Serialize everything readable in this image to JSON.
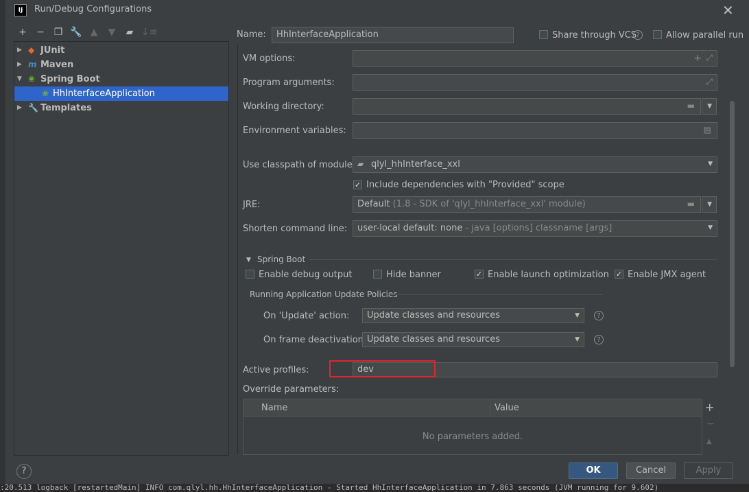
{
  "window": {
    "title": "Run/Debug Configurations",
    "logo": "IJ"
  },
  "toolbar": {
    "icons": [
      "add-icon",
      "remove-icon",
      "copy-icon",
      "wrench-icon",
      "move-up-icon",
      "move-down-icon",
      "folder-icon",
      "sort-icon"
    ]
  },
  "tree": {
    "items": [
      {
        "label": "JUnit",
        "icon": "junit-icon"
      },
      {
        "label": "Maven",
        "icon": "maven-icon"
      },
      {
        "label": "Spring Boot",
        "icon": "spring-boot-icon"
      },
      {
        "label": "HhInterfaceApplication",
        "icon": "spring-app-icon"
      },
      {
        "label": "Templates",
        "icon": "wrench-icon"
      }
    ]
  },
  "header": {
    "name_label": "Name:",
    "name_value": "HhInterfaceApplication",
    "share_label": "Share through VCS",
    "allow_parallel_label": "Allow parallel run"
  },
  "form": {
    "vm_options_label": "VM options:",
    "program_args_label": "Program arguments:",
    "working_dir_label": "Working directory:",
    "env_vars_label": "Environment variables:",
    "classpath_label": "Use classpath of module:",
    "classpath_value": "qlyl_hhInterface_xxl",
    "include_deps_label": "Include dependencies with \"Provided\" scope",
    "jre_label": "JRE:",
    "jre_value": "Default",
    "jre_detail": "(1.8 - SDK of 'qlyl_hhInterface_xxl' module)",
    "shorten_label": "Shorten command line:",
    "shorten_value": "user-local default: none",
    "shorten_detail": "- java [options] classname [args]"
  },
  "spring_boot": {
    "section_label": "Spring Boot",
    "enable_debug_label": "Enable debug output",
    "hide_banner_label": "Hide banner",
    "enable_launch_label": "Enable launch optimization",
    "enable_jmx_label": "Enable JMX agent",
    "policies_label": "Running Application Update Policies",
    "on_update_label": "On 'Update' action:",
    "on_update_value": "Update classes and resources",
    "on_frame_label": "On frame deactivation:",
    "on_frame_value": "Update classes and resources",
    "active_profiles_label": "Active profiles:",
    "active_profiles_value": "dev",
    "override_label": "Override parameters:",
    "table_col_name": "Name",
    "table_col_value": "Value",
    "table_empty": "No parameters added."
  },
  "buttons": {
    "ok": "OK",
    "cancel": "Cancel",
    "apply": "Apply",
    "help": "?"
  },
  "background_log": ":20.513 logback [restartedMain] INFO  com.qlyl.hh.HhInterfaceApplication - Started HhInterfaceApplication in 7.863 seconds (JVM running for 9.602)",
  "colors": {
    "selection": "#2f65ca",
    "highlight": "#e0262e",
    "primary_button": "#365880"
  }
}
